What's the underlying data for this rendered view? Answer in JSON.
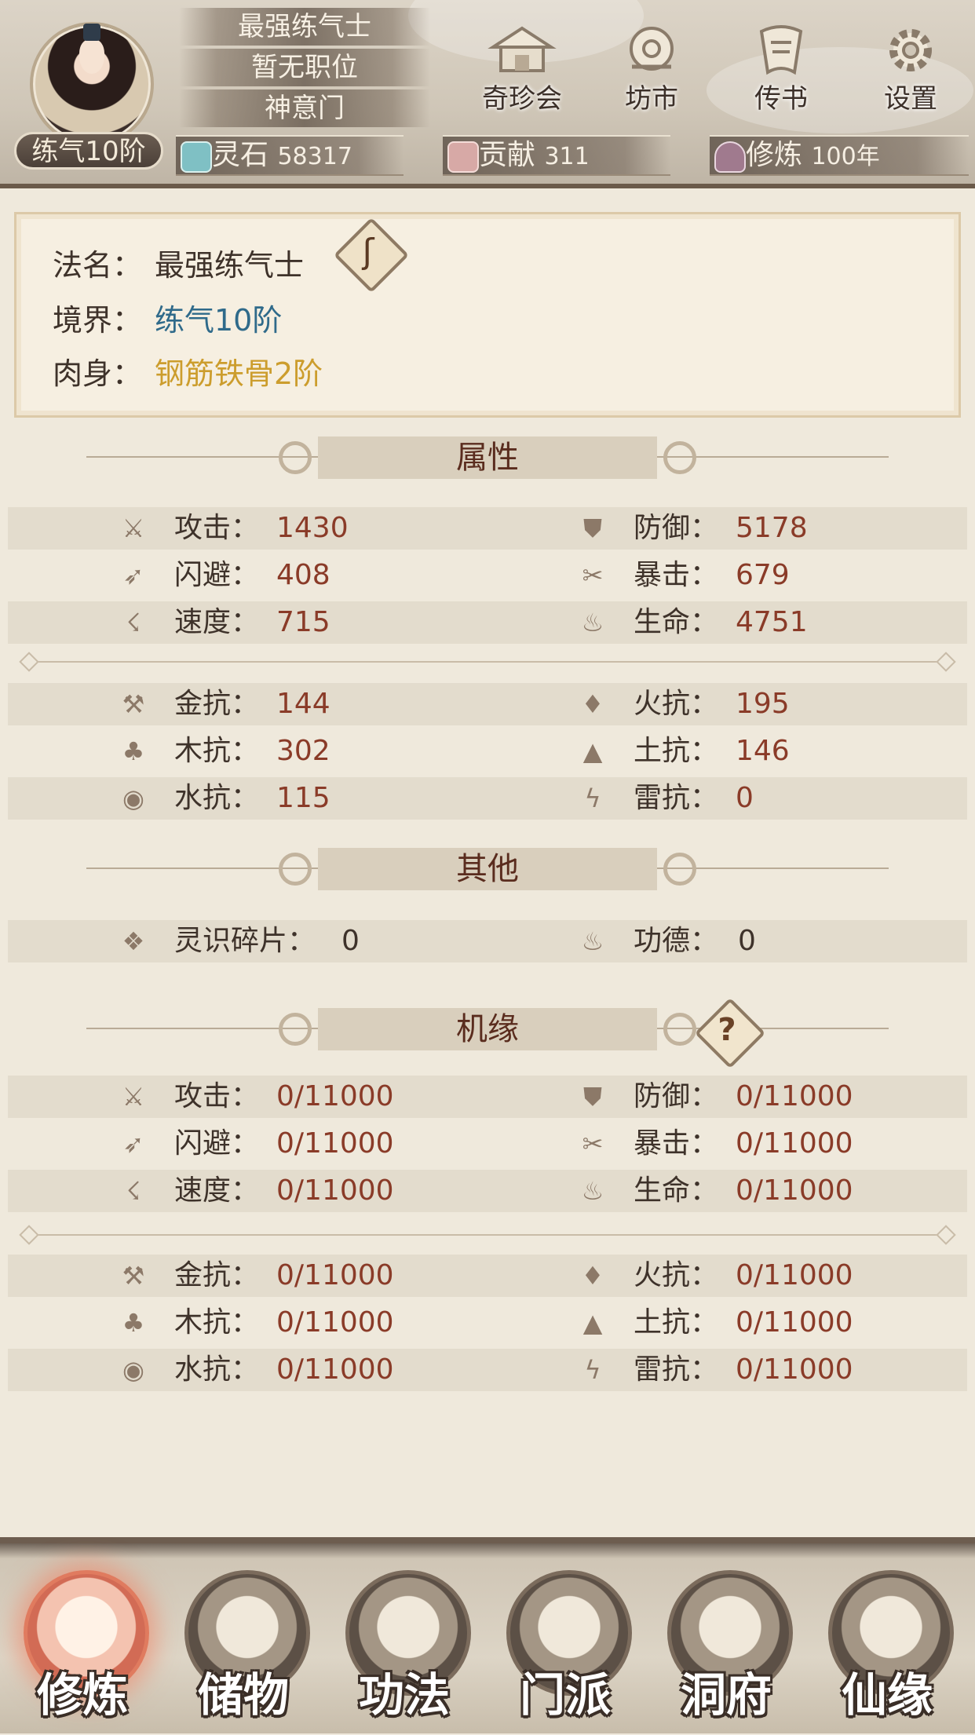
{
  "header": {
    "realm_badge": "练气10阶",
    "plates": [
      "最强练气士",
      "暂无职位",
      "神意门"
    ],
    "nav": [
      {
        "label": "奇珍会",
        "icon": "treasure-pavilion-icon"
      },
      {
        "label": "坊市",
        "icon": "market-icon"
      },
      {
        "label": "传书",
        "icon": "letter-scroll-icon"
      },
      {
        "label": "设置",
        "icon": "gear-icon"
      }
    ],
    "resources": [
      {
        "label": "灵石",
        "value": "58317",
        "icon": "spirit-stone-icon"
      },
      {
        "label": "贡献",
        "value": "311",
        "icon": "contribution-icon"
      },
      {
        "label": "修炼",
        "value": "100年",
        "icon": "cultivation-icon"
      }
    ]
  },
  "info": {
    "name_key": "法名：",
    "name_val": "最强练气士",
    "realm_key": "境界：",
    "realm_val": "练气10阶",
    "body_key": "肉身：",
    "body_val": "钢筋铁骨2阶",
    "colors": {
      "realm": "#2f6a8a",
      "body": "#cc9d2d"
    }
  },
  "attributes": {
    "title": "属性",
    "rows": [
      [
        {
          "label": "攻击：",
          "value": "1430",
          "icon": "attack-icon"
        },
        {
          "label": "防御：",
          "value": "5178",
          "icon": "defense-icon"
        }
      ],
      [
        {
          "label": "闪避：",
          "value": "408",
          "icon": "dodge-icon"
        },
        {
          "label": "暴击：",
          "value": "679",
          "icon": "critical-icon"
        }
      ],
      [
        {
          "label": "速度：",
          "value": "715",
          "icon": "speed-icon"
        },
        {
          "label": "生命：",
          "value": "4751",
          "icon": "life-icon"
        }
      ]
    ],
    "resist_rows": [
      [
        {
          "label": "金抗：",
          "value": "144",
          "icon": "metal-icon"
        },
        {
          "label": "火抗：",
          "value": "195",
          "icon": "fire-icon"
        }
      ],
      [
        {
          "label": "木抗：",
          "value": "302",
          "icon": "wood-icon"
        },
        {
          "label": "土抗：",
          "value": "146",
          "icon": "earth-icon"
        }
      ],
      [
        {
          "label": "水抗：",
          "value": "115",
          "icon": "water-icon"
        },
        {
          "label": "雷抗：",
          "value": "0",
          "icon": "thunder-icon"
        }
      ]
    ]
  },
  "others": {
    "title": "其他",
    "rows": [
      [
        {
          "label": "灵识碎片：",
          "value": "0",
          "icon": "spirit-shard-icon"
        },
        {
          "label": "功德：",
          "value": "0",
          "icon": "merit-icon"
        }
      ]
    ]
  },
  "fortune": {
    "title": "机缘",
    "help_glyph": "?",
    "rows": [
      [
        {
          "label": "攻击：",
          "value": "0/11000",
          "icon": "attack-icon"
        },
        {
          "label": "防御：",
          "value": "0/11000",
          "icon": "defense-icon"
        }
      ],
      [
        {
          "label": "闪避：",
          "value": "0/11000",
          "icon": "dodge-icon"
        },
        {
          "label": "暴击：",
          "value": "0/11000",
          "icon": "critical-icon"
        }
      ],
      [
        {
          "label": "速度：",
          "value": "0/11000",
          "icon": "speed-icon"
        },
        {
          "label": "生命：",
          "value": "0/11000",
          "icon": "life-icon"
        }
      ]
    ],
    "resist_rows": [
      [
        {
          "label": "金抗：",
          "value": "0/11000",
          "icon": "metal-icon"
        },
        {
          "label": "火抗：",
          "value": "0/11000",
          "icon": "fire-icon"
        }
      ],
      [
        {
          "label": "木抗：",
          "value": "0/11000",
          "icon": "wood-icon"
        },
        {
          "label": "土抗：",
          "value": "0/11000",
          "icon": "earth-icon"
        }
      ],
      [
        {
          "label": "水抗：",
          "value": "0/11000",
          "icon": "water-icon"
        },
        {
          "label": "雷抗：",
          "value": "0/11000",
          "icon": "thunder-icon"
        }
      ]
    ]
  },
  "bottom_nav": [
    {
      "label": "修炼",
      "icon": "meditation-icon",
      "active": true
    },
    {
      "label": "储物",
      "icon": "storage-bag-icon",
      "active": false
    },
    {
      "label": "功法",
      "icon": "technique-scroll-icon",
      "active": false
    },
    {
      "label": "门派",
      "icon": "sect-gate-icon",
      "active": false
    },
    {
      "label": "洞府",
      "icon": "cave-dwelling-icon",
      "active": false
    },
    {
      "label": "仙缘",
      "icon": "immortal-fate-icon",
      "active": false
    }
  ]
}
